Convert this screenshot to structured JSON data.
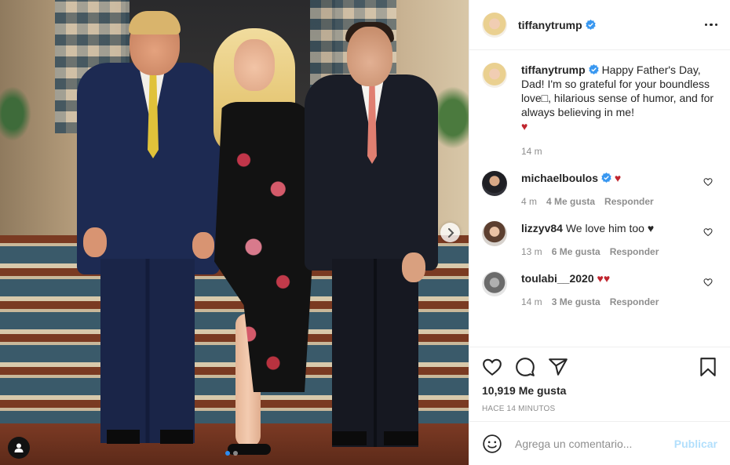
{
  "post": {
    "author": "tiffanytrump",
    "caption": "Happy Father's Day, Dad! I'm so grateful for your boundless love□, hilarious sense of humor, and for always believing in me!",
    "caption_heart": "♥",
    "caption_time": "14 m",
    "likes": "10,919 Me gusta",
    "posted_ago": "HACE 14 MINUTOS"
  },
  "comments": [
    {
      "user": "michaelboulos",
      "verified": true,
      "text": "",
      "emoji": "♥",
      "time": "4 m",
      "likes": "4 Me gusta",
      "reply": "Responder"
    },
    {
      "user": "lizzyv84",
      "verified": false,
      "text": "We love him too",
      "emoji": "♥",
      "time": "13 m",
      "likes": "6 Me gusta",
      "reply": "Responder"
    },
    {
      "user": "toulabi__2020",
      "verified": false,
      "text": "",
      "emoji": "♥♥",
      "time": "14 m",
      "likes": "3 Me gusta",
      "reply": "Responder"
    }
  ],
  "comment_box": {
    "placeholder": "Agrega un comentario...",
    "publish": "Publicar"
  },
  "carousel": {
    "total": 2,
    "current": 1
  },
  "colors": {
    "verified": "#3897f0",
    "heart": "#c0252e",
    "publish_disabled": "#b2dffc",
    "muted": "#8e8e8e"
  },
  "icons": [
    "verified-icon",
    "more-options-icon",
    "heart-outline-icon",
    "comment-icon",
    "share-icon",
    "bookmark-icon",
    "emoji-icon",
    "chevron-right-icon",
    "user-tag-icon"
  ]
}
